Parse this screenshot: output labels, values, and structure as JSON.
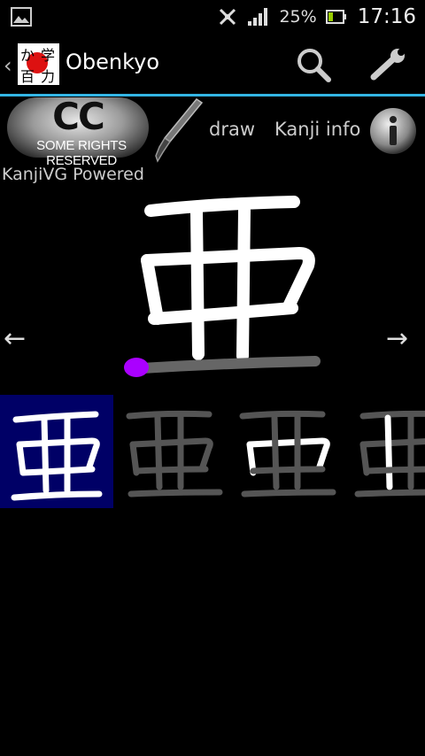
{
  "status_bar": {
    "icons": [
      "gallery-notification-icon",
      "mute-icon",
      "signal-icon",
      "battery-icon"
    ],
    "battery_percent": "25%",
    "time": "17:16"
  },
  "action_bar": {
    "title": "Obenkyo",
    "app_icon_text": [
      "か",
      "学",
      "百",
      "力"
    ],
    "actions": [
      "search-icon",
      "wrench-icon"
    ],
    "accent_color": "#33b5e5"
  },
  "toolbar": {
    "cc_letters": "CC",
    "cc_text": "SOME RIGHTS RESERVED",
    "draw_label": "draw",
    "kanji_info_label": "Kanji info",
    "kanjivg_label": "KanjiVG Powered"
  },
  "kanji": {
    "character": "亜",
    "stroke_highlight_color": "#aa00ff",
    "nav_prev": "←",
    "nav_next": "→"
  },
  "thumbnails": [
    {
      "selected": true
    },
    {
      "selected": false
    },
    {
      "selected": false
    },
    {
      "selected": false
    }
  ]
}
